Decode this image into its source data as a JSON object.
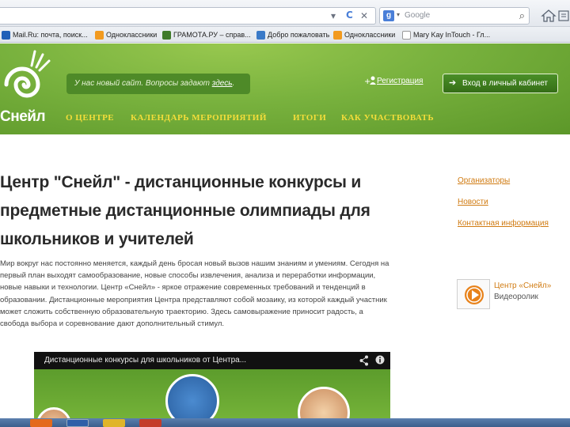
{
  "browser": {
    "url_controls": {
      "dropdown": "▾",
      "reload": "C",
      "close": "✕"
    },
    "search": {
      "engine_letter": "g",
      "placeholder": "Google",
      "dropdown": "▾",
      "search_glyph": "⌕"
    }
  },
  "bookmarks": [
    {
      "label": "Mail.Ru: почта, поиск...",
      "icon_color": "#1f5fb8"
    },
    {
      "label": "Одноклассники",
      "icon_color": "#f29a1f"
    },
    {
      "label": "ГРАМОТА.РУ – справ...",
      "icon_color": "#3f7a2a"
    },
    {
      "label": "Добро пожаловать",
      "icon_color": "#3a7ac8"
    },
    {
      "label": "Одноклассники",
      "icon_color": "#f29a1f"
    },
    {
      "label": "Mary Kay InTouch - Гл...",
      "icon_color": "#ffffff"
    }
  ],
  "site": {
    "logo_text": "Снейл",
    "notice_text": "У нас новый сайт. Вопросы задают ",
    "notice_link": "здесь",
    "notice_end": ".",
    "register_label": "Регистрация",
    "login_label": "Вход в личный кабинет",
    "nav": [
      "О ЦЕНТРЕ",
      "КАЛЕНДАРЬ МЕРОПРИЯТИЙ",
      "ИТОГИ",
      "КАК УЧАСТВОВАТЬ"
    ]
  },
  "content": {
    "title_lines": [
      "Центр \"Снейл\" - дистанционные конкурсы и",
      "предметные дистанционные олимпиады для",
      "школьников и учителей"
    ],
    "paragraph_lines": [
      "Мир вокруг нас постоянно меняется, каждый день бросая новый вызов нашим знаниям и умениям. Сегодня на",
      "первый план выходят самообразование, новые способы извлечения, анализа и переработки информации,",
      "новые навыки и технологии. Центр «Снейл» - яркое отражение современных требований и тенденций в",
      "образовании. Дистанционные мероприятия Центра представляют собой мозаику, из которой каждый участник",
      "может сложить собственную образовательную траекторию. Здесь самовыражение приносит радость, а",
      "свобода выбора и соревнование дают дополнительный стимул."
    ]
  },
  "sidebar": {
    "links": [
      "Организаторы",
      "Новости",
      "Контактная информация"
    ],
    "video_title": "Центр «Снейл»",
    "video_sub": "Видеоролик"
  },
  "player": {
    "title": "Дистанционные конкурсы для школьников от Центра..."
  },
  "colors": {
    "header_green": "#79b23e",
    "nav_yellow": "#f3dd3a",
    "link_orange": "#d07b12"
  }
}
